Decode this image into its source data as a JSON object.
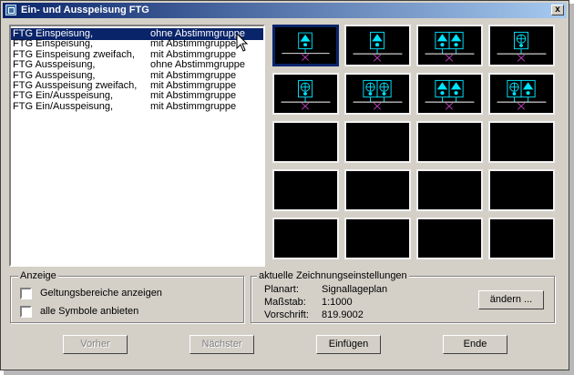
{
  "window": {
    "title": "Ein- und Ausspeisung FTG",
    "close_label": "x"
  },
  "list": {
    "rows": [
      {
        "name": "FTG Einspeisung,",
        "group": "ohne Abstimmgruppe"
      },
      {
        "name": "FTG Einspeisung,",
        "group": "mit Abstimmgruppe"
      },
      {
        "name": "FTG Einspeisung zweifach,",
        "group": "mit Abstimmgruppe"
      },
      {
        "name": "FTG Ausspeisung,",
        "group": "ohne Abstimmgruppe"
      },
      {
        "name": "FTG Ausspeisung,",
        "group": "mit Abstimmgruppe"
      },
      {
        "name": "FTG Ausspeisung zweifach,",
        "group": "mit Abstimmgruppe"
      },
      {
        "name": "FTG Ein/Ausspeisung,",
        "group": "mit Abstimmgruppe"
      },
      {
        "name": "FTG Ein/Ausspeisung,",
        "group": "mit Abstimmgruppe"
      }
    ],
    "selected_index": 0
  },
  "symbols": {
    "symbol_color": "#00e5ff",
    "line_color": "#ffffff",
    "anchor_color": "#c040c0",
    "tiles": [
      {
        "icon": "single-arrow-up-symbol-icon",
        "glyphs": [
          "arrow"
        ]
      },
      {
        "icon": "single-arrow-up-symbol-icon",
        "glyphs": [
          "arrow"
        ]
      },
      {
        "icon": "double-arrow-up-symbol-icon",
        "glyphs": [
          "arrow",
          "arrow"
        ]
      },
      {
        "icon": "single-circle-cross-symbol-icon",
        "glyphs": [
          "cross"
        ]
      },
      {
        "icon": "single-circle-cross-symbol-icon",
        "glyphs": [
          "cross"
        ]
      },
      {
        "icon": "double-circle-cross-symbol-icon",
        "glyphs": [
          "cross",
          "cross"
        ]
      },
      {
        "icon": "double-arrow-up-symbol-icon",
        "glyphs": [
          "arrow",
          "arrow"
        ]
      },
      {
        "icon": "circle-cross-and-arrow-symbol-icon",
        "glyphs": [
          "cross",
          "arrow"
        ]
      },
      {
        "icon": "",
        "glyphs": []
      },
      {
        "icon": "",
        "glyphs": []
      },
      {
        "icon": "",
        "glyphs": []
      },
      {
        "icon": "",
        "glyphs": []
      },
      {
        "icon": "",
        "glyphs": []
      },
      {
        "icon": "",
        "glyphs": []
      },
      {
        "icon": "",
        "glyphs": []
      },
      {
        "icon": "",
        "glyphs": []
      },
      {
        "icon": "",
        "glyphs": []
      },
      {
        "icon": "",
        "glyphs": []
      },
      {
        "icon": "",
        "glyphs": []
      },
      {
        "icon": "",
        "glyphs": []
      }
    ],
    "selected_index": 0
  },
  "anzeige": {
    "label": "Anzeige",
    "options": [
      {
        "label": "Geltungsbereiche anzeigen",
        "checked": false
      },
      {
        "label": "alle Symbole anbieten",
        "checked": false
      }
    ]
  },
  "settings": {
    "label": "aktuelle Zeichnungseinstellungen",
    "rows": [
      {
        "key": "Planart:",
        "value": "Signallageplan"
      },
      {
        "key": "Maßstab:",
        "value": "1:1000"
      },
      {
        "key": "Vorschrift:",
        "value": "819.9002"
      }
    ],
    "change_label": "ändern ..."
  },
  "buttons": {
    "prev": "Vorher",
    "next": "Nächster",
    "insert": "Einfügen",
    "end": "Ende"
  }
}
